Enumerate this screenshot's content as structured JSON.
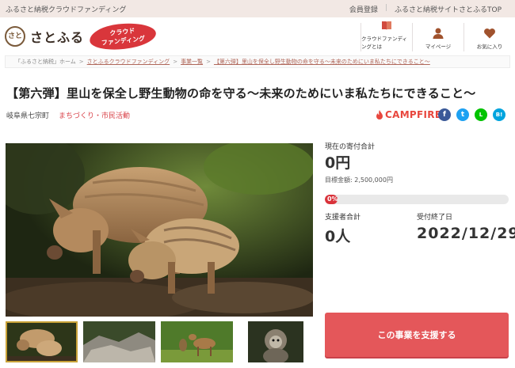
{
  "topbar": {
    "tagline": "ふるさと納税クラウドファンディング",
    "links": [
      "会員登録",
      "ふるさと納税サイトさとふるTOP"
    ]
  },
  "header": {
    "logo_text": "さとふる",
    "logo_mark": "さと",
    "badge_line1": "クラウド",
    "badge_line2": "ファンディング",
    "nav": [
      {
        "label": "クラウドファンディングとは",
        "icon": "book-icon"
      },
      {
        "label": "マイページ",
        "icon": "user-icon"
      },
      {
        "label": "お気に入り",
        "icon": "heart-icon"
      }
    ]
  },
  "breadcrumb": {
    "items": [
      "「ふるさと納税」ホーム",
      "さとふるクラウドファンディング",
      "事業一覧",
      "【第六弾】里山を保全し野生動物の命を守る〜未来のためにいま私たちにできること〜"
    ]
  },
  "project": {
    "title": "【第六弾】里山を保全し野生動物の命を守る〜未来のためにいま私たちにできること〜",
    "location": "岐阜県七宗町",
    "category": "まちづくり・市民活動",
    "partner": "CAMPFIRE",
    "social": [
      {
        "name": "facebook",
        "glyph": "f",
        "color": "#3b5998"
      },
      {
        "name": "twitter",
        "glyph": "t",
        "color": "#1da1f2"
      },
      {
        "name": "line",
        "glyph": "L",
        "color": "#00c300"
      },
      {
        "name": "hatena",
        "glyph": "B!",
        "color": "#00a4de"
      }
    ]
  },
  "stats": {
    "current_label": "現在の寄付合計",
    "current_value": "0円",
    "goal_text": "目標金額: 2,500,000円",
    "progress_text": "0%",
    "progress_fraction": 0.0,
    "supporters_label": "支援者合計",
    "supporters_value": "0人",
    "deadline_label": "受付終了日",
    "deadline_value": "2022/12/29"
  },
  "cta_label": "この事業を支援する",
  "colors": {
    "accent": "#d9363b",
    "cta": "#e4575a",
    "topbar": "#f2e8e4"
  }
}
